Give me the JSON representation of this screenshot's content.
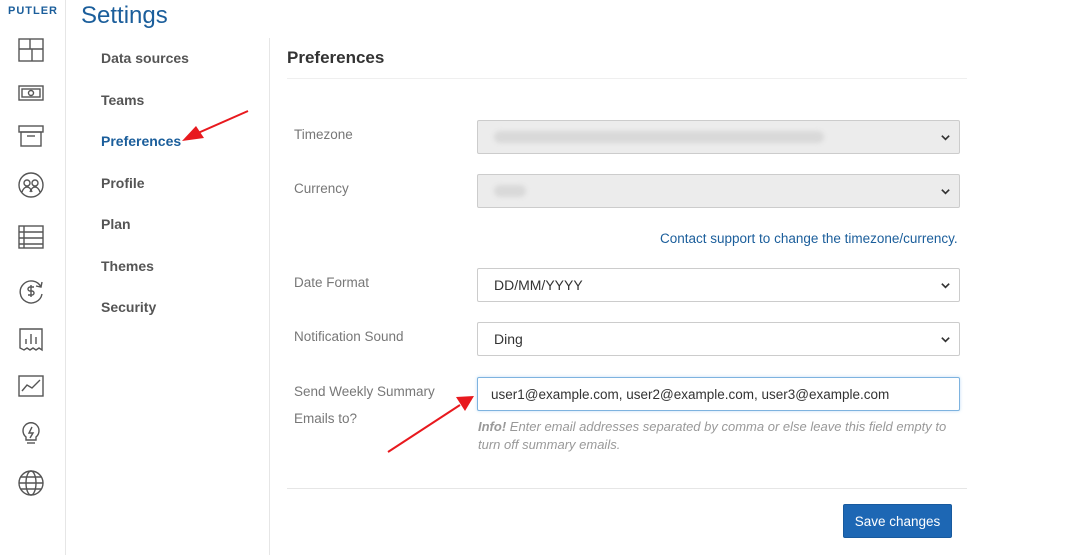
{
  "brand": "PUTLER",
  "page_title": "Settings",
  "rail_icons": [
    "dashboard-icon",
    "money-icon",
    "archive-icon",
    "customers-icon",
    "list-icon",
    "subscription-icon",
    "reports-icon",
    "chart-icon",
    "insights-icon",
    "globe-icon"
  ],
  "nav": {
    "items": [
      {
        "label": "Data sources"
      },
      {
        "label": "Teams"
      },
      {
        "label": "Preferences",
        "active": true
      },
      {
        "label": "Profile"
      },
      {
        "label": "Plan"
      },
      {
        "label": "Themes"
      },
      {
        "label": "Security"
      }
    ]
  },
  "preferences": {
    "title": "Preferences",
    "timezone_label": "Timezone",
    "currency_label": "Currency",
    "support_link": "Contact support to change the timezone/currency.",
    "date_format_label": "Date Format",
    "date_format_value": "DD/MM/YYYY",
    "notification_label": "Notification Sound",
    "notification_value": "Ding",
    "weekly_label_line1": "Send Weekly Summary",
    "weekly_label_line2": "Emails to?",
    "weekly_value": "user1@example.com, user2@example.com, user3@example.com",
    "info_prefix": "Info!",
    "info_text": " Enter email addresses separated by comma or else leave this field empty to turn off summary emails.",
    "save_label": "Save changes"
  },
  "colors": {
    "accent": "#1b5e9b",
    "button": "#1d67b4",
    "annotation_arrow": "#e8191e"
  }
}
